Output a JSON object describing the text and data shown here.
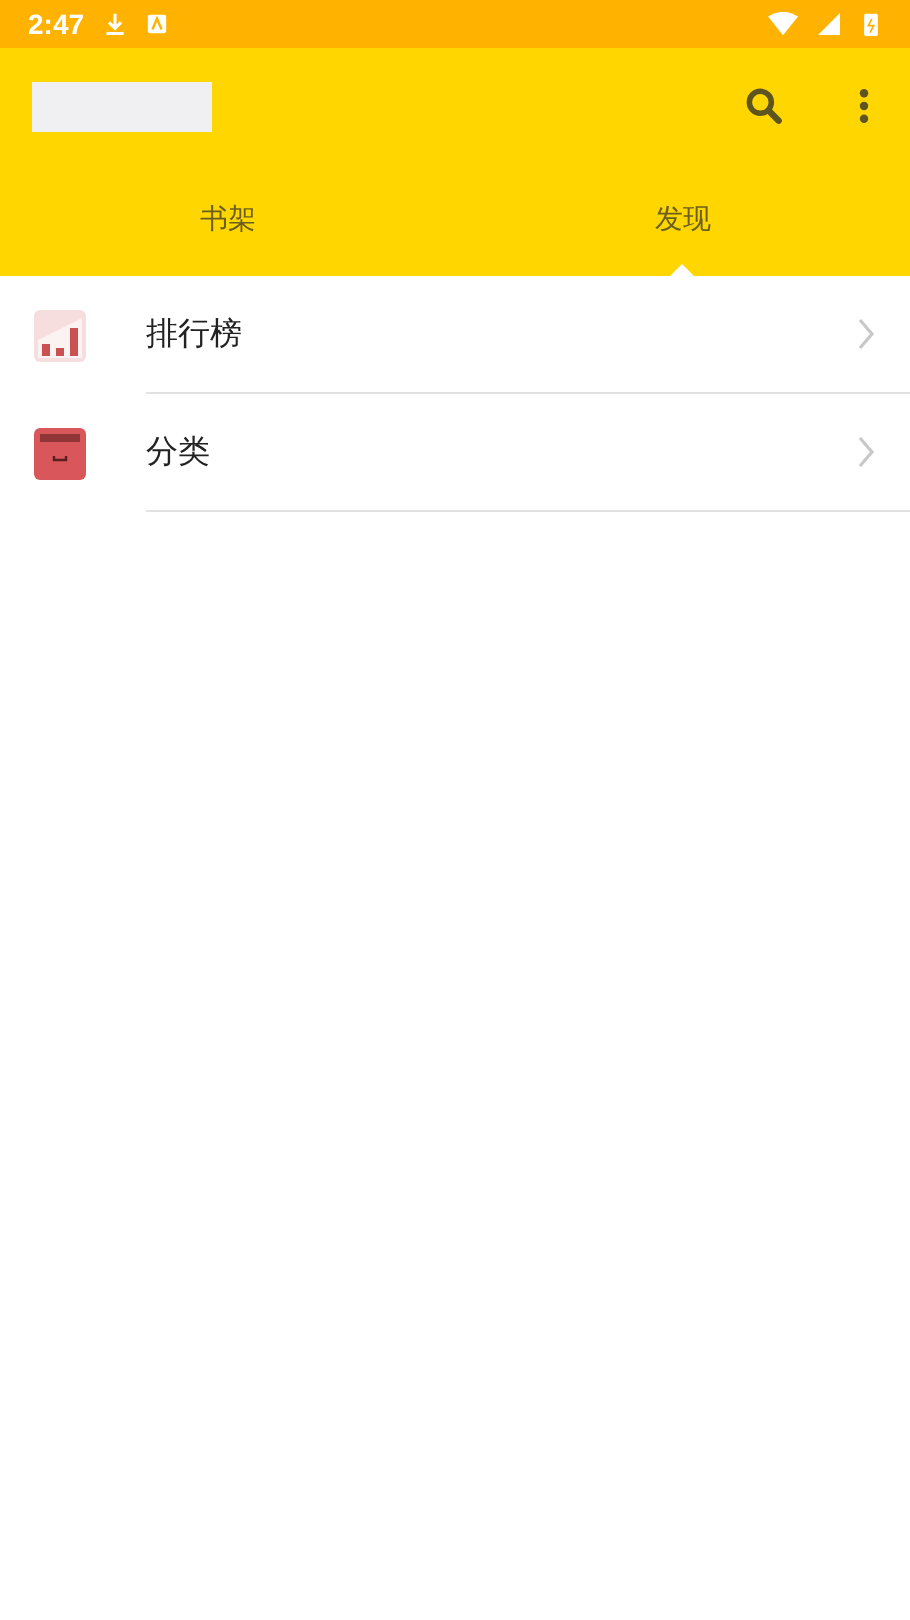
{
  "status_bar": {
    "time": "2:47"
  },
  "tabs": [
    {
      "label": "书架",
      "selected": false
    },
    {
      "label": "发现",
      "selected": true
    }
  ],
  "items": [
    {
      "label": "排行榜",
      "kind": "chart"
    },
    {
      "label": "分类",
      "kind": "drawer"
    }
  ]
}
